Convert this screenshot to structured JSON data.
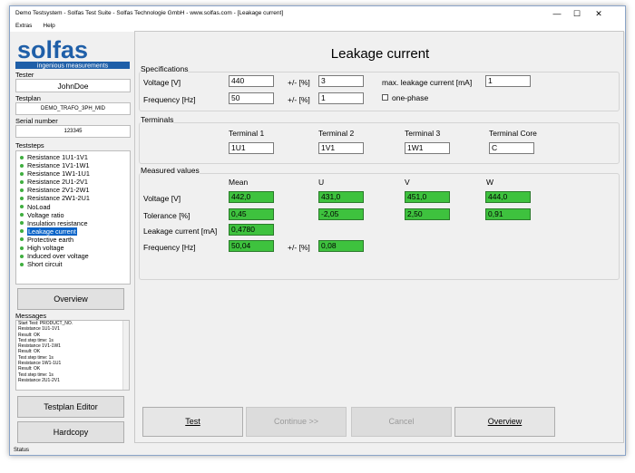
{
  "window": {
    "title": "Demo Testsystem - Solfas Test Suite - Solfas Technologie GmbH - www.solfas.com - [Leakage current]"
  },
  "menu": [
    "Extras",
    "Help"
  ],
  "logo": {
    "name": "solfas",
    "tagline": "ingenious measurements",
    "color": "#1f5fa8"
  },
  "sidebar": {
    "tester_label": "Tester",
    "tester": "JohnDoe",
    "testplan_label": "Testplan",
    "testplan": "DEMO_TRAFO_3PH_MID",
    "serial_label": "Serial number",
    "serial": "123345",
    "teststeps_label": "Teststeps",
    "steps": [
      "Resistance 1U1-1V1",
      "Resistance 1V1-1W1",
      "Resistance 1W1-1U1",
      "Resistance 2U1-2V1",
      "Resistance 2V1-2W1",
      "Resistance 2W1-2U1",
      "NoLoad",
      "Voltage ratio",
      "Insulation resistance",
      "Leakage current",
      "Protective earth",
      "High voltage",
      "Induced over voltage",
      "Short circuit"
    ],
    "selected_step": 9,
    "overview": "Overview",
    "messages_label": "Messages",
    "messages": [
      "Start Test: PRODUCT_NO.",
      "Resistance 1U1-1V1",
      "Result: OK",
      "Test step time: 1s",
      "Resistance 1V1-1W1",
      "Result: OK",
      "Test step time: 1s",
      "Resistance 1W1-1U1",
      "Result: OK",
      "Test step time: 1s",
      "Resistance 2U1-2V1"
    ],
    "testplan_editor": "Testplan Editor",
    "hardcopy": "Hardcopy"
  },
  "main": {
    "title": "Leakage current",
    "spec": {
      "label": "Specifications",
      "voltage_label": "Voltage [V]",
      "voltage": "440",
      "tol1_label": "+/- [%]",
      "tol1": "3",
      "maxleak_label": "max. leakage current [mA]",
      "maxleak": "1",
      "freq_label": "Frequency [Hz]",
      "freq": "50",
      "tol2_label": "+/- [%]",
      "tol2": "1",
      "onephase_label": "one-phase"
    },
    "terminals": {
      "label": "Terminals",
      "t1_label": "Terminal 1",
      "t1": "1U1",
      "t2_label": "Terminal 2",
      "t2": "1V1",
      "t3_label": "Terminal 3",
      "t3": "1W1",
      "tc_label": "Terminal Core",
      "tc": "C"
    },
    "measured": {
      "label": "Measured values",
      "h_mean": "Mean",
      "h_u": "U",
      "h_v": "V",
      "h_w": "W",
      "voltage_label": "Voltage [V]",
      "voltage": [
        "442,0",
        "431,0",
        "451,0",
        "444,0"
      ],
      "tolerance_label": "Tolerance [%]",
      "tolerance": [
        "0,45",
        "-2,05",
        "2,50",
        "0,91"
      ],
      "leak_label": "Leakage current [mA]",
      "leak": "0,4780",
      "freq_label": "Frequency [Hz]",
      "freq": "50,04",
      "freq_tol_label": "+/- [%]",
      "freq_tol": "0,08"
    },
    "buttons": {
      "test": "Test",
      "continue": "Continue >>",
      "cancel": "Cancel",
      "overview": "Overview"
    }
  },
  "status": "Status"
}
